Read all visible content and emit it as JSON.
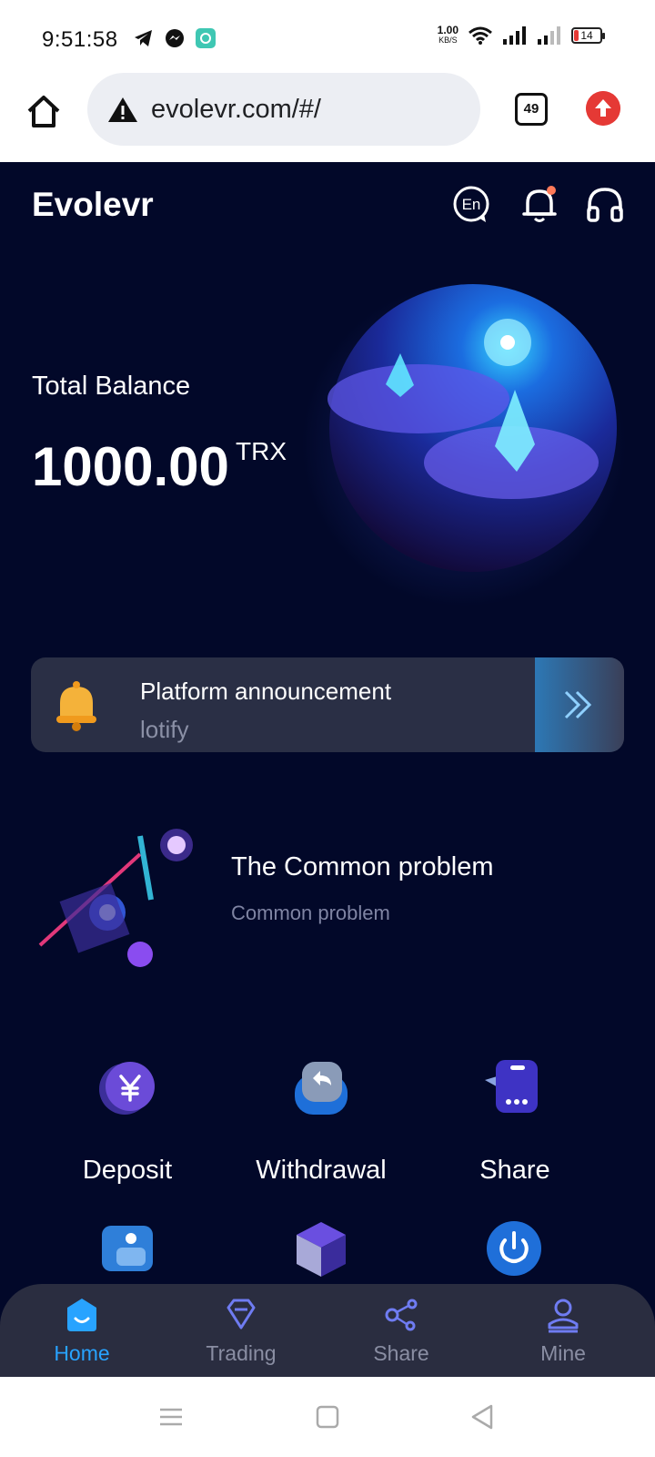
{
  "status_bar": {
    "time": "9:51:58",
    "net_speed_value": "1.00",
    "net_speed_unit": "KB/S",
    "battery_level": "14"
  },
  "browser": {
    "url": "evolevr.com/#/",
    "tab_count": "49"
  },
  "app": {
    "brand": "Evolevr",
    "header_icons": [
      "language-icon",
      "notification-bell-icon",
      "headset-support-icon"
    ],
    "language_label": "En",
    "balance": {
      "label": "Total Balance",
      "value": "1000.00",
      "unit": "TRX"
    },
    "announcement": {
      "title": "Platform announcement",
      "ticker": "lotify"
    },
    "common_problem": {
      "title": "The Common problem",
      "subtitle": "Common problem"
    },
    "actions": [
      {
        "label": "Deposit",
        "icon": "yen-coin-icon"
      },
      {
        "label": "Withdrawal",
        "icon": "return-arrow-icon"
      },
      {
        "label": "Share",
        "icon": "share-phone-icon"
      }
    ],
    "bottom_nav": [
      {
        "label": "Home",
        "icon": "home-icon",
        "active": true
      },
      {
        "label": "Trading",
        "icon": "diamond-icon",
        "active": false
      },
      {
        "label": "Share",
        "icon": "share-nodes-icon",
        "active": false
      },
      {
        "label": "Mine",
        "icon": "user-icon",
        "active": false
      }
    ]
  },
  "colors": {
    "app_background": "#020829",
    "card_background": "#2a2f45",
    "nav_background": "#2a2d40",
    "active_blue": "#28a3ff",
    "inactive_gray": "#8a8ea3"
  }
}
